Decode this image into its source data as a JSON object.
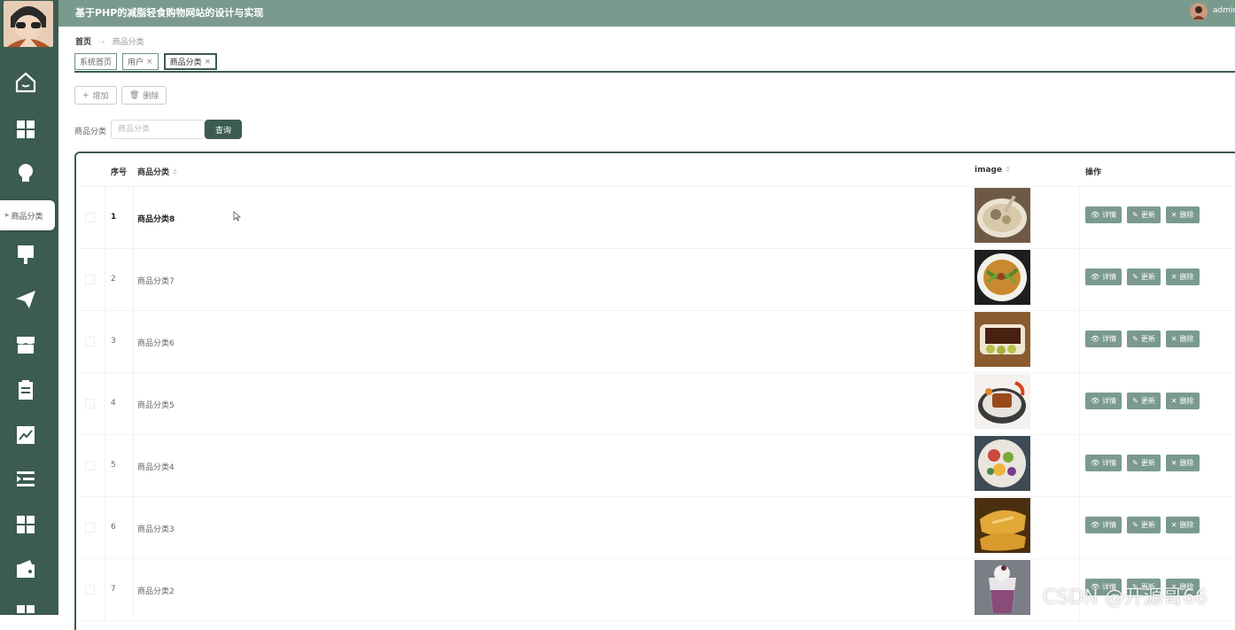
{
  "app": {
    "title": "基于PHP的减脂轻食购物网站的设计与实现",
    "user_name": "admin"
  },
  "sidebar": {
    "tooltip": "商品分类",
    "icons": [
      "home-icon",
      "grid-icon",
      "lightbulb-icon",
      "brush-icon",
      "paper-plane-icon",
      "store-icon",
      "clipboard-icon",
      "chart-line-icon",
      "indent-list-icon",
      "grid-icon",
      "wallet-icon",
      "grid-icon"
    ]
  },
  "breadcrumb": {
    "home": "首页",
    "current": "商品分类"
  },
  "tabs": [
    {
      "label": "系统首页",
      "closable": false,
      "active": false
    },
    {
      "label": "用户",
      "closable": true,
      "active": false
    },
    {
      "label": "商品分类",
      "closable": true,
      "active": true
    }
  ],
  "toolbar": {
    "add_label": "增加",
    "delete_label": "删除"
  },
  "search": {
    "label": "商品分类",
    "placeholder": "商品分类",
    "button_label": "查询"
  },
  "table": {
    "headers": {
      "index": "序号",
      "category": "商品分类",
      "image": "image",
      "actions": "操作"
    },
    "action_labels": {
      "detail": "详情",
      "update": "更新",
      "delete": "删除"
    },
    "rows": [
      {
        "index": "1",
        "name": "商品分类8",
        "image": "soup"
      },
      {
        "index": "2",
        "name": "商品分类7",
        "image": "noodles"
      },
      {
        "index": "3",
        "name": "商品分类6",
        "image": "meat"
      },
      {
        "index": "4",
        "name": "商品分类5",
        "image": "dish"
      },
      {
        "index": "5",
        "name": "商品分类4",
        "image": "salad"
      },
      {
        "index": "6",
        "name": "商品分类3",
        "image": "bread"
      },
      {
        "index": "7",
        "name": "商品分类2",
        "image": "drink"
      }
    ]
  },
  "colors": {
    "sidebar": "#3b5c4f",
    "topbar": "#7b9a8e",
    "accent": "#3b5c4f",
    "action_button": "#7b9a8e"
  },
  "watermark": "CSDN @开源哥66"
}
